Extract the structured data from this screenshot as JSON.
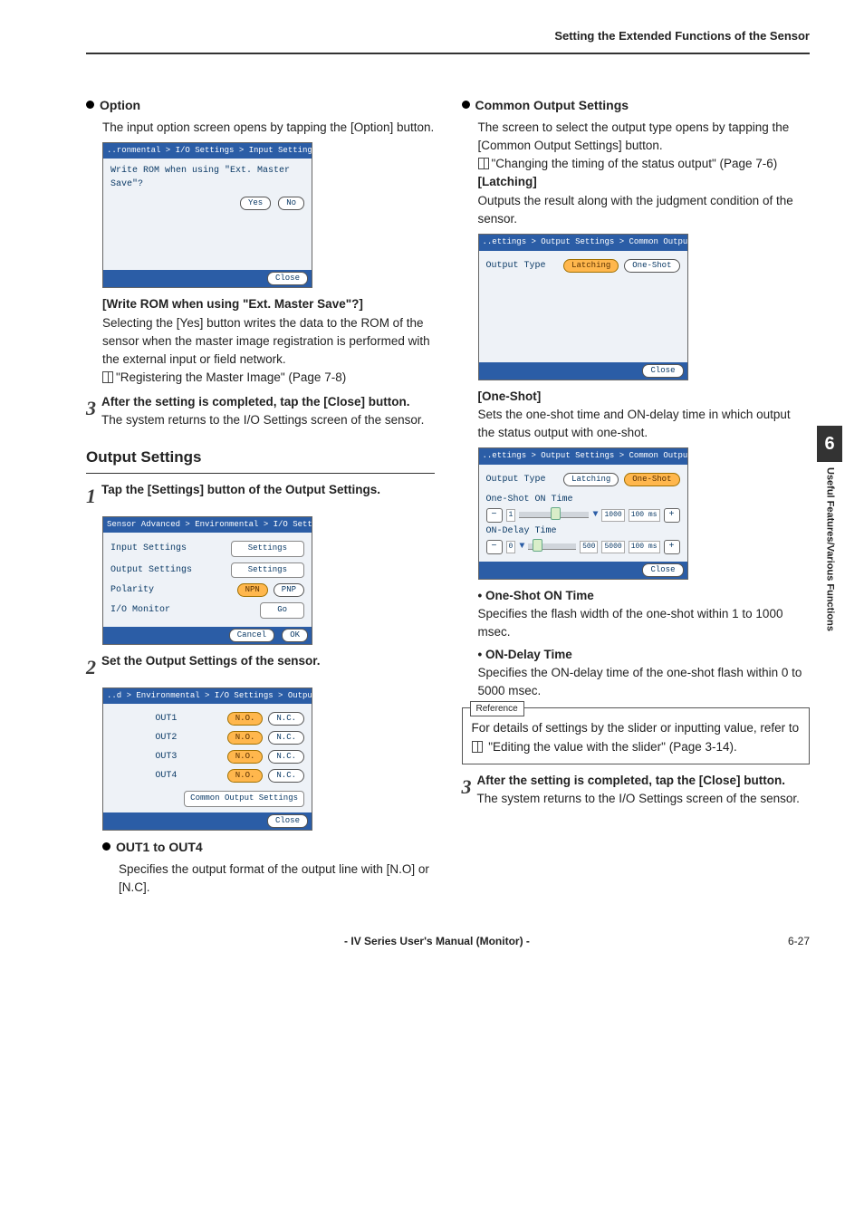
{
  "header": "Setting the Extended Functions of the Sensor",
  "sidetab": {
    "num": "6",
    "label": "Useful Features/Various Functions"
  },
  "left": {
    "option": {
      "title": "Option",
      "desc": "The input option screen opens by tapping the [Option] button.",
      "ss_bar": "..ronmental > I/O Settings > Input Settings > Option",
      "ss_q": "Write ROM when using \"Ext. Master Save\"?",
      "btn_yes": "Yes",
      "btn_no": "No",
      "btn_close": "Close",
      "write_rom_hd": "[Write ROM when using \"Ext. Master Save\"?]",
      "write_rom_body": "Selecting the [Yes] button writes the data to the ROM of the sensor when the master image registration is performed with the external input or field network.",
      "ref": "\"Registering the Master Image\" (Page 7-8)"
    },
    "step3": {
      "hd": "After the setting is completed, tap the [Close] button.",
      "body": "The system returns to the I/O Settings screen of the sensor."
    },
    "output": {
      "title": "Output Settings",
      "step1": "Tap the [Settings] button of the Output Settings.",
      "ss1_bar": "Sensor Advanced > Environmental > I/O Settings",
      "rows": {
        "input": "Input Settings",
        "input_btn": "Settings",
        "output": "Output Settings",
        "output_btn": "Settings",
        "polarity": "Polarity",
        "npn": "NPN",
        "pnp": "PNP",
        "ionm": "I/O Monitor",
        "go": "Go",
        "cancel": "Cancel",
        "ok": "OK"
      },
      "step2": "Set the Output Settings of the sensor.",
      "ss2_bar": "..d > Environmental > I/O Settings > Output Settings",
      "outs": {
        "o1": "OUT1",
        "o2": "OUT2",
        "o3": "OUT3",
        "o4": "OUT4",
        "no": "N.O.",
        "nc": "N.C.",
        "cos": "Common Output Settings",
        "close": "Close"
      },
      "out14_hd": "OUT1 to OUT4",
      "out14_body": "Specifies the output format of the output line with [N.O] or [N.C]."
    }
  },
  "right": {
    "cos": {
      "title": "Common Output Settings",
      "desc": "The screen to select the output type opens by tapping the [Common Output Settings] button.",
      "ref": "\"Changing the timing of the status output\" (Page 7-6)",
      "latching_hd": "[Latching]",
      "latching_body": "Outputs the result along with the judgment condition of the sensor.",
      "ss_bar": "..ettings > Output Settings > Common Output Settings",
      "outtype": "Output Type",
      "latching": "Latching",
      "oneshot": "One-Shot",
      "close": "Close",
      "oneshot_hd": "[One-Shot]",
      "oneshot_body": "Sets the one-shot time and ON-delay time in which output the status output with one-shot.",
      "oson": "One-Shot ON Time",
      "ondly": "ON-Delay Time",
      "v1": "1",
      "v1000": "1000",
      "v100ms": "100 ms",
      "v0": "0",
      "v500": "500",
      "v5000": "5000",
      "sub_oson_hd": "• One-Shot ON Time",
      "sub_oson": "Specifies the flash width of the one-shot within 1 to 1000 msec.",
      "sub_ondly_hd": "• ON-Delay Time",
      "sub_ondly": "Specifies the ON-delay time of the one-shot flash within 0 to 5000 msec.",
      "reference_tag": "Reference",
      "reference": "For details of settings by the slider or inputting value, refer to ",
      "reference_link": "\"Editing the value with the slider\" (Page 3-14)."
    },
    "step3": {
      "hd": "After the setting is completed, tap the [Close] button.",
      "body": "The system returns to the I/O Settings screen of the sensor."
    }
  },
  "footer": {
    "center": "- IV Series User's Manual (Monitor) -",
    "page": "6-27"
  }
}
